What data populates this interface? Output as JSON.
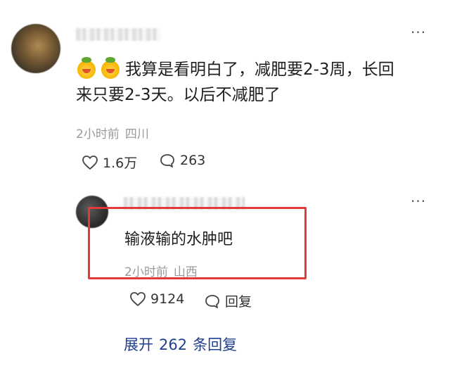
{
  "comment": {
    "content_line1": "我算是看明白了，减肥要2-3周，长回",
    "content_line2": "来只要2-3天。以后不减肥了",
    "time": "2小时前",
    "location": "四川",
    "likes": "1.6万",
    "replies": "263",
    "emoji_icon": "melon-emoji-icon",
    "more_icon": "···"
  },
  "reply": {
    "content": "输液输的水肿吧",
    "time": "2小时前",
    "location": "山西",
    "likes": "9124",
    "reply_label": "回复",
    "more_icon": "···",
    "highlight_color": "#e03a3a"
  },
  "expand": {
    "prefix": "展开",
    "count": "262",
    "suffix": "条回复"
  }
}
